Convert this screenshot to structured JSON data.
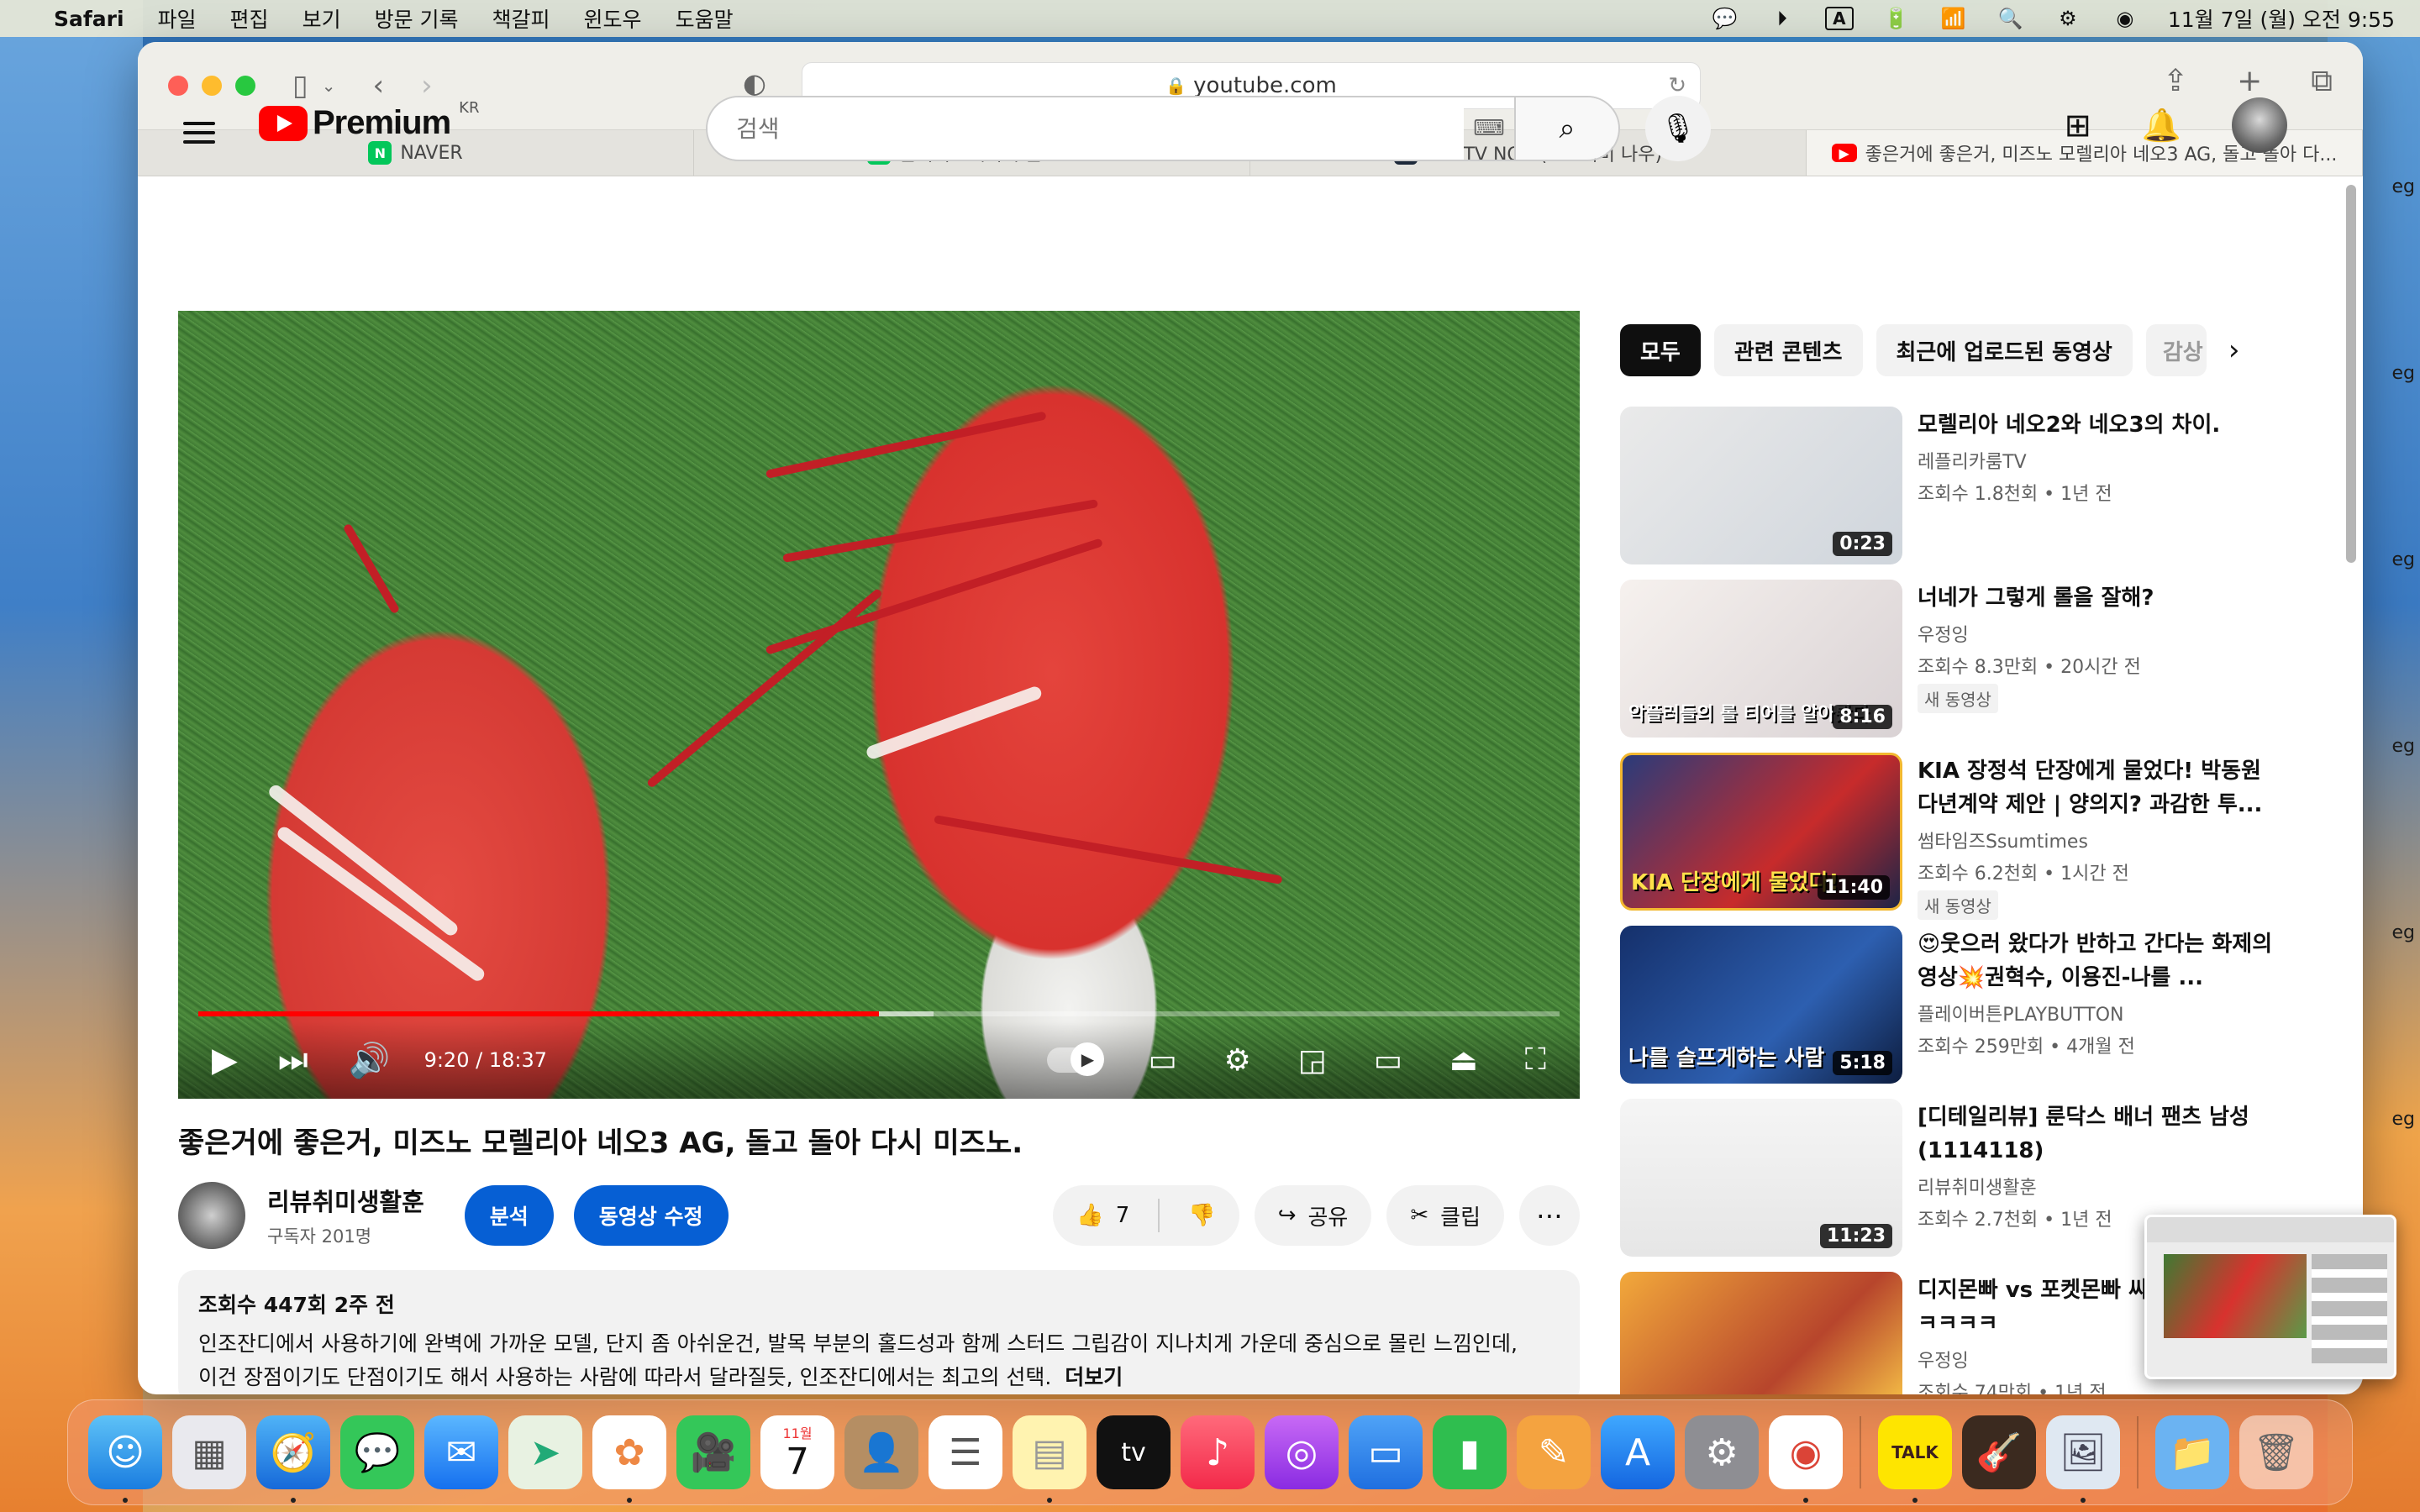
{
  "menubar": {
    "app": "Safari",
    "items": [
      "파일",
      "편집",
      "보기",
      "방문 기록",
      "책갈피",
      "윈도우",
      "도움말"
    ],
    "datetime": "11월 7일 (월) 오전 9:55"
  },
  "browser": {
    "url": "youtube.com",
    "tabs": [
      {
        "label": "NAVER",
        "icon": "naver-icon"
      },
      {
        "label": "훈이이 : 네이버 블로그",
        "icon": "blog-icon"
      },
      {
        "label": "SPOTV NOW(스포티비 나우)",
        "icon": "spotv-icon"
      },
      {
        "label": "좋은거에 좋은거, 미즈노 모렐리아 네오3 AG, 돌고 돌아 다...",
        "icon": "youtube-icon"
      }
    ]
  },
  "youtube": {
    "logo_text": "Premium",
    "region": "KR",
    "search_placeholder": "검색"
  },
  "player": {
    "time": "9:20 / 18:37",
    "progress_fraction": 0.5
  },
  "video": {
    "title": "좋은거에 좋은거, 미즈노 모렐리아 네오3 AG, 돌고 돌아 다시 미즈노.",
    "channel": "리뷰취미생활훈",
    "subscribers": "구독자 201명",
    "analytics_label": "분석",
    "edit_label": "동영상 수정",
    "likes": "7",
    "share_label": "공유",
    "clip_label": "클립",
    "meta": "조회수 447회  2주 전",
    "description_1": "인조잔디에서 사용하기에 완벽에 가까운 모델, 단지 좀 아쉬운건, 발목 부분의 홀드성과 함께 스터드 그립감이 지나치게 가운데 중심으로 몰린 느낌인데,",
    "description_2": "이건 장점이기도 단점이기도 해서 사용하는 사람에 따라서 달라질듯, 인조잔디에서는 최고의 선택.",
    "more_label": "더보기"
  },
  "chips": [
    "모두",
    "관련 콘텐츠",
    "최근에 업로드된 동영상",
    "감상"
  ],
  "recommended": [
    {
      "title": "모렐리아 네오2와 네오3의 차이.",
      "channel": "레플리카룸TV",
      "meta": "조회수 1.8천회 • 1년 전",
      "duration": "0:23",
      "caption": "",
      "badge": ""
    },
    {
      "title": "너네가 그렇게 롤을 잘해?",
      "channel": "우정잉",
      "meta": "조회수 8.3만회 • 20시간 전",
      "duration": "8:16",
      "caption": "악플러들의 롤 티어를 알아봤다",
      "badge": "새 동영상"
    },
    {
      "title": "KIA 장정석 단장에게 물었다! 박동원 다년계약 제안 | 양의지? 과감한 투...",
      "channel": "썸타임즈Ssumtimes",
      "meta": "조회수 6.2천회 • 1시간 전",
      "duration": "11:40",
      "caption": "KIA 단장에게 물었다!",
      "badge": "새 동영상"
    },
    {
      "title": "😍웃으러 왔다가 반하고 간다는 화제의 영상💥권혁수, 이용진-나를 ...",
      "channel": "플레이버튼PLAYBUTTON",
      "meta": "조회수 259만회 • 4개월 전",
      "duration": "5:18",
      "caption": "나를 슬프게하는 사람",
      "badge": ""
    },
    {
      "title": "[디테일리뷰] 룬닥스 배너 팬츠 남성 (1114118)",
      "channel": "리뷰취미생활훈",
      "meta": "조회수 2.7천회 • 1년 전",
      "duration": "11:23",
      "caption": "",
      "badge": ""
    },
    {
      "title": "디지몬빠 vs 포켓몬빠 싸움 니닭ㅋㅋㅋㅋㅋㅋ",
      "channel": "우정잉",
      "meta": "조회수 74만회 • 1년 전",
      "duration": "",
      "caption": "",
      "badge": ""
    }
  ],
  "side_edge_text": "eg",
  "dock_calendar": {
    "month": "11월",
    "day": "7"
  },
  "dock_kakao": "TALK"
}
